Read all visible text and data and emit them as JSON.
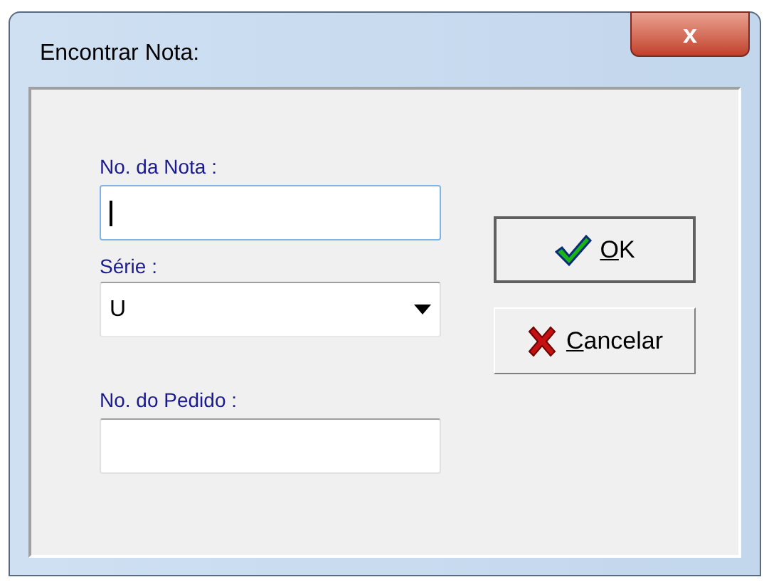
{
  "window": {
    "title": "Encontrar Nota:",
    "close_glyph": "x"
  },
  "fields": [
    {
      "kind": "text",
      "label": "No. da Nota :",
      "focused": true
    },
    {
      "kind": "combo",
      "label": "Série :",
      "value": "U"
    },
    {
      "kind": "text",
      "label": "No. do Pedido :",
      "focused": false
    }
  ],
  "buttons": [
    {
      "kind": "ok",
      "label": "OK",
      "mnemonic_first": true
    },
    {
      "kind": "cancel",
      "label": "Cancelar",
      "mnemonic_first": true
    }
  ]
}
